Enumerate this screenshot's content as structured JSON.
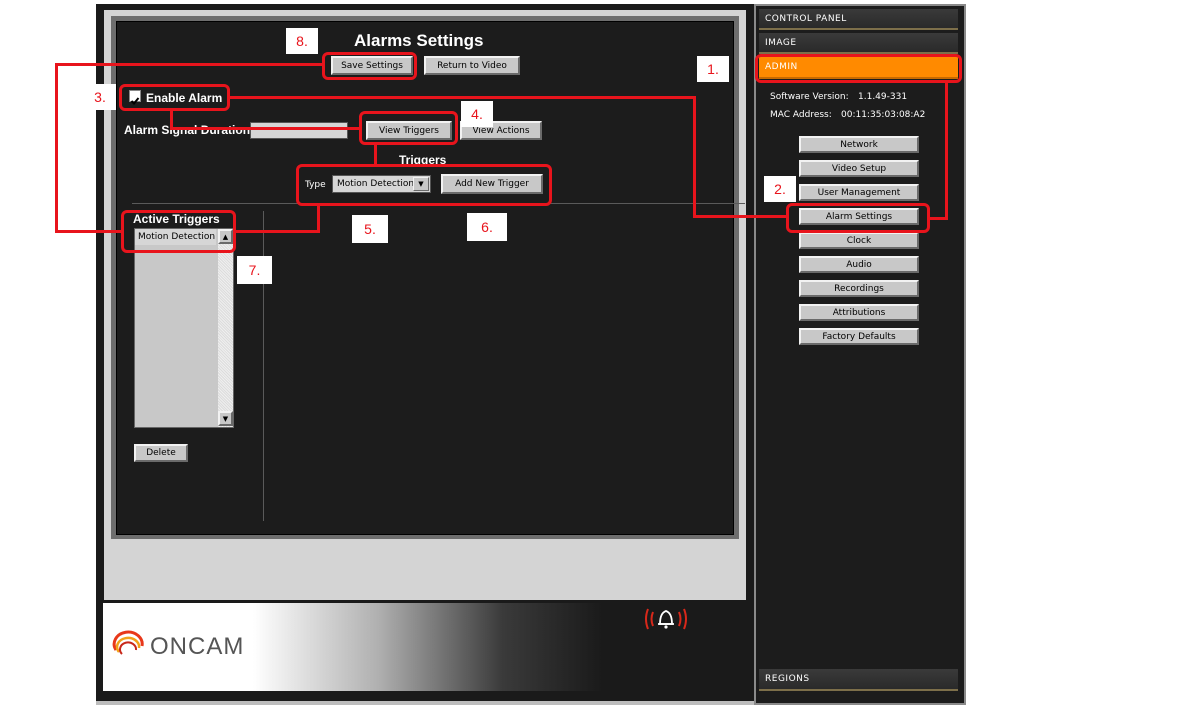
{
  "page": {
    "title": "Alarms Settings",
    "save_label": "Save Settings",
    "return_label": "Return to Video",
    "enable_alarm_label": "Enable Alarm",
    "enable_alarm_checked": true,
    "signal_duration_label": "Alarm Signal Duration",
    "signal_duration_value": "",
    "view_triggers_label": "View Triggers",
    "view_actions_label": "View Actions",
    "triggers_heading": "Triggers",
    "type_label": "Type",
    "type_value": "Motion Detection",
    "add_trigger_label": "Add New Trigger",
    "active_triggers_heading": "Active Triggers",
    "active_triggers": [
      "Motion Detection"
    ],
    "delete_label": "Delete"
  },
  "sidebar": {
    "tabs": {
      "control_panel": "CONTROL PANEL",
      "image": "IMAGE",
      "admin": "ADMIN",
      "regions": "REGIONS"
    },
    "software_version_label": "Software Version:",
    "software_version": "1.1.49-331",
    "mac_label": "MAC Address:",
    "mac": "00:11:35:03:08:A2",
    "items": [
      {
        "label": "Network"
      },
      {
        "label": "Video Setup"
      },
      {
        "label": "User Management"
      },
      {
        "label": "Alarm Settings"
      },
      {
        "label": "Clock"
      },
      {
        "label": "Audio"
      },
      {
        "label": "Recordings"
      },
      {
        "label": "Attributions"
      },
      {
        "label": "Factory Defaults"
      }
    ]
  },
  "footer": {
    "logo_text": "ONCAM",
    "alarm_icon": "alarm-bell-icon"
  },
  "annotations": [
    "1.",
    "2.",
    "3.",
    "4.",
    "5.",
    "6.",
    "7.",
    "8."
  ],
  "colors": {
    "annotation": "#e8141c",
    "admin_tab": "#ff8a00",
    "panel_bg": "#1c1c1c"
  }
}
